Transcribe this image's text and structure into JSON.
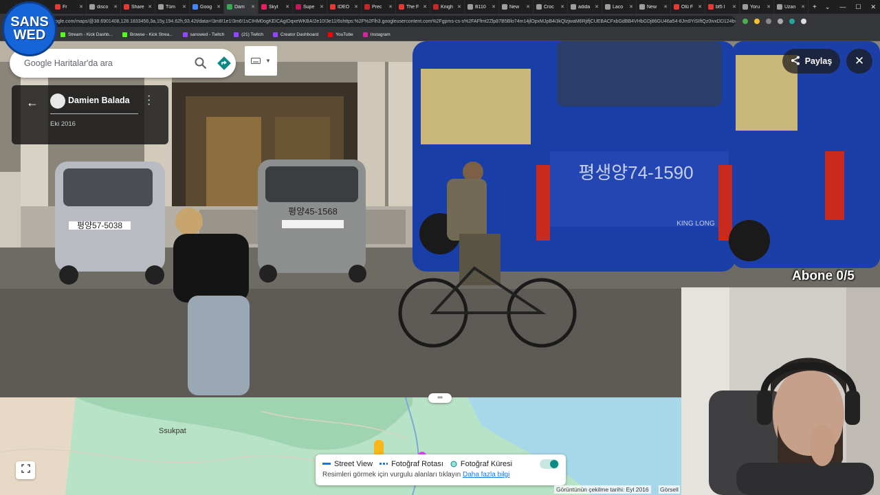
{
  "browser": {
    "tabs": [
      {
        "label": "Fr",
        "color": "#e53935"
      },
      {
        "label": "disco",
        "color": "#9e9e9e"
      },
      {
        "label": "Share",
        "color": "#e53935"
      },
      {
        "label": "Tüm",
        "color": "#9e9e9e"
      },
      {
        "label": "Goog",
        "color": "#4285f4"
      },
      {
        "label": "Dam",
        "color": "#34a853",
        "active": true
      },
      {
        "label": "Skyt",
        "color": "#e91e63"
      },
      {
        "label": "Supe",
        "color": "#c2185b"
      },
      {
        "label": "IDEO",
        "color": "#e53935"
      },
      {
        "label": "Prec",
        "color": "#c62828"
      },
      {
        "label": "The F",
        "color": "#e53935"
      },
      {
        "label": "Knigh",
        "color": "#c62828"
      },
      {
        "label": "B110",
        "color": "#9e9e9e"
      },
      {
        "label": "New",
        "color": "#9e9e9e"
      },
      {
        "label": "Croc",
        "color": "#9e9e9e"
      },
      {
        "label": "adida",
        "color": "#9e9e9e"
      },
      {
        "label": "Laco",
        "color": "#9e9e9e"
      },
      {
        "label": "New",
        "color": "#9e9e9e"
      },
      {
        "label": "Ölü F",
        "color": "#e53935"
      },
      {
        "label": "bf5 l",
        "color": "#e53935"
      },
      {
        "label": "Yoru",
        "color": "#9e9e9e"
      },
      {
        "label": "Uzan",
        "color": "#9e9e9e"
      }
    ],
    "new_tab": "+",
    "url": "ogle.com/maps/@38.6901408,128.1833456,3a,15y,194.62h,93.42t/data=!3m8!1e1!3m6!1sCIHM0ogKEICAgIDqxeWKBA!2e10!3e11!6shttps:%2F%2Flh3.googleusercontent.com%2Fgpms-cs-s%2FAFfmt2Zlp87B5Blo74m14jlOpxMJpB4i3kQlzjwaM6RjtfjCUEBACFxbGdBB4VHbGDj86GU46a54-8Jm9YiSIftQz0ivxDD124bwU-...",
    "bookmarks": [
      {
        "label": "Stream - Kick Dashb...",
        "color": "#53fc18"
      },
      {
        "label": "Browse - Kick Strea...",
        "color": "#53fc18"
      },
      {
        "label": "sanswed - Twitch",
        "color": "#9146ff"
      },
      {
        "label": "(21) Twitch",
        "color": "#9146ff"
      },
      {
        "label": "Creator Dashboard",
        "color": "#9146ff"
      },
      {
        "label": "YouTube",
        "color": "#ff0000"
      },
      {
        "label": "Instagram",
        "color": "#d6249f"
      }
    ]
  },
  "logo": {
    "line1": "SANS",
    "line2": "WED"
  },
  "search": {
    "placeholder": "Google Haritalar'da ara"
  },
  "photo_info": {
    "author": "Damien Balada",
    "date": "Eki 2016"
  },
  "share_label": "Paylaş",
  "subscriber_counter": "Abone 0/5",
  "scene_text": {
    "van1_plate": "평양57-5038",
    "van2_plate": "평양45-1568",
    "bus_plate": "평생양74-1590",
    "bus_brand": "KING LONG"
  },
  "map": {
    "place": "Ssukpat",
    "legend": {
      "street_view": "Street View",
      "photo_route": "Fotoğraf Rotası",
      "photo_sphere": "Fotoğraf Küresi",
      "hint": "Resimleri görmek için vurgulu alanları tıklayın",
      "more_link": "Daha fazla bilgi"
    },
    "capture_date": "Görüntünün çekilme tarihi: Eyl 2016",
    "images_link": "Görsell"
  }
}
